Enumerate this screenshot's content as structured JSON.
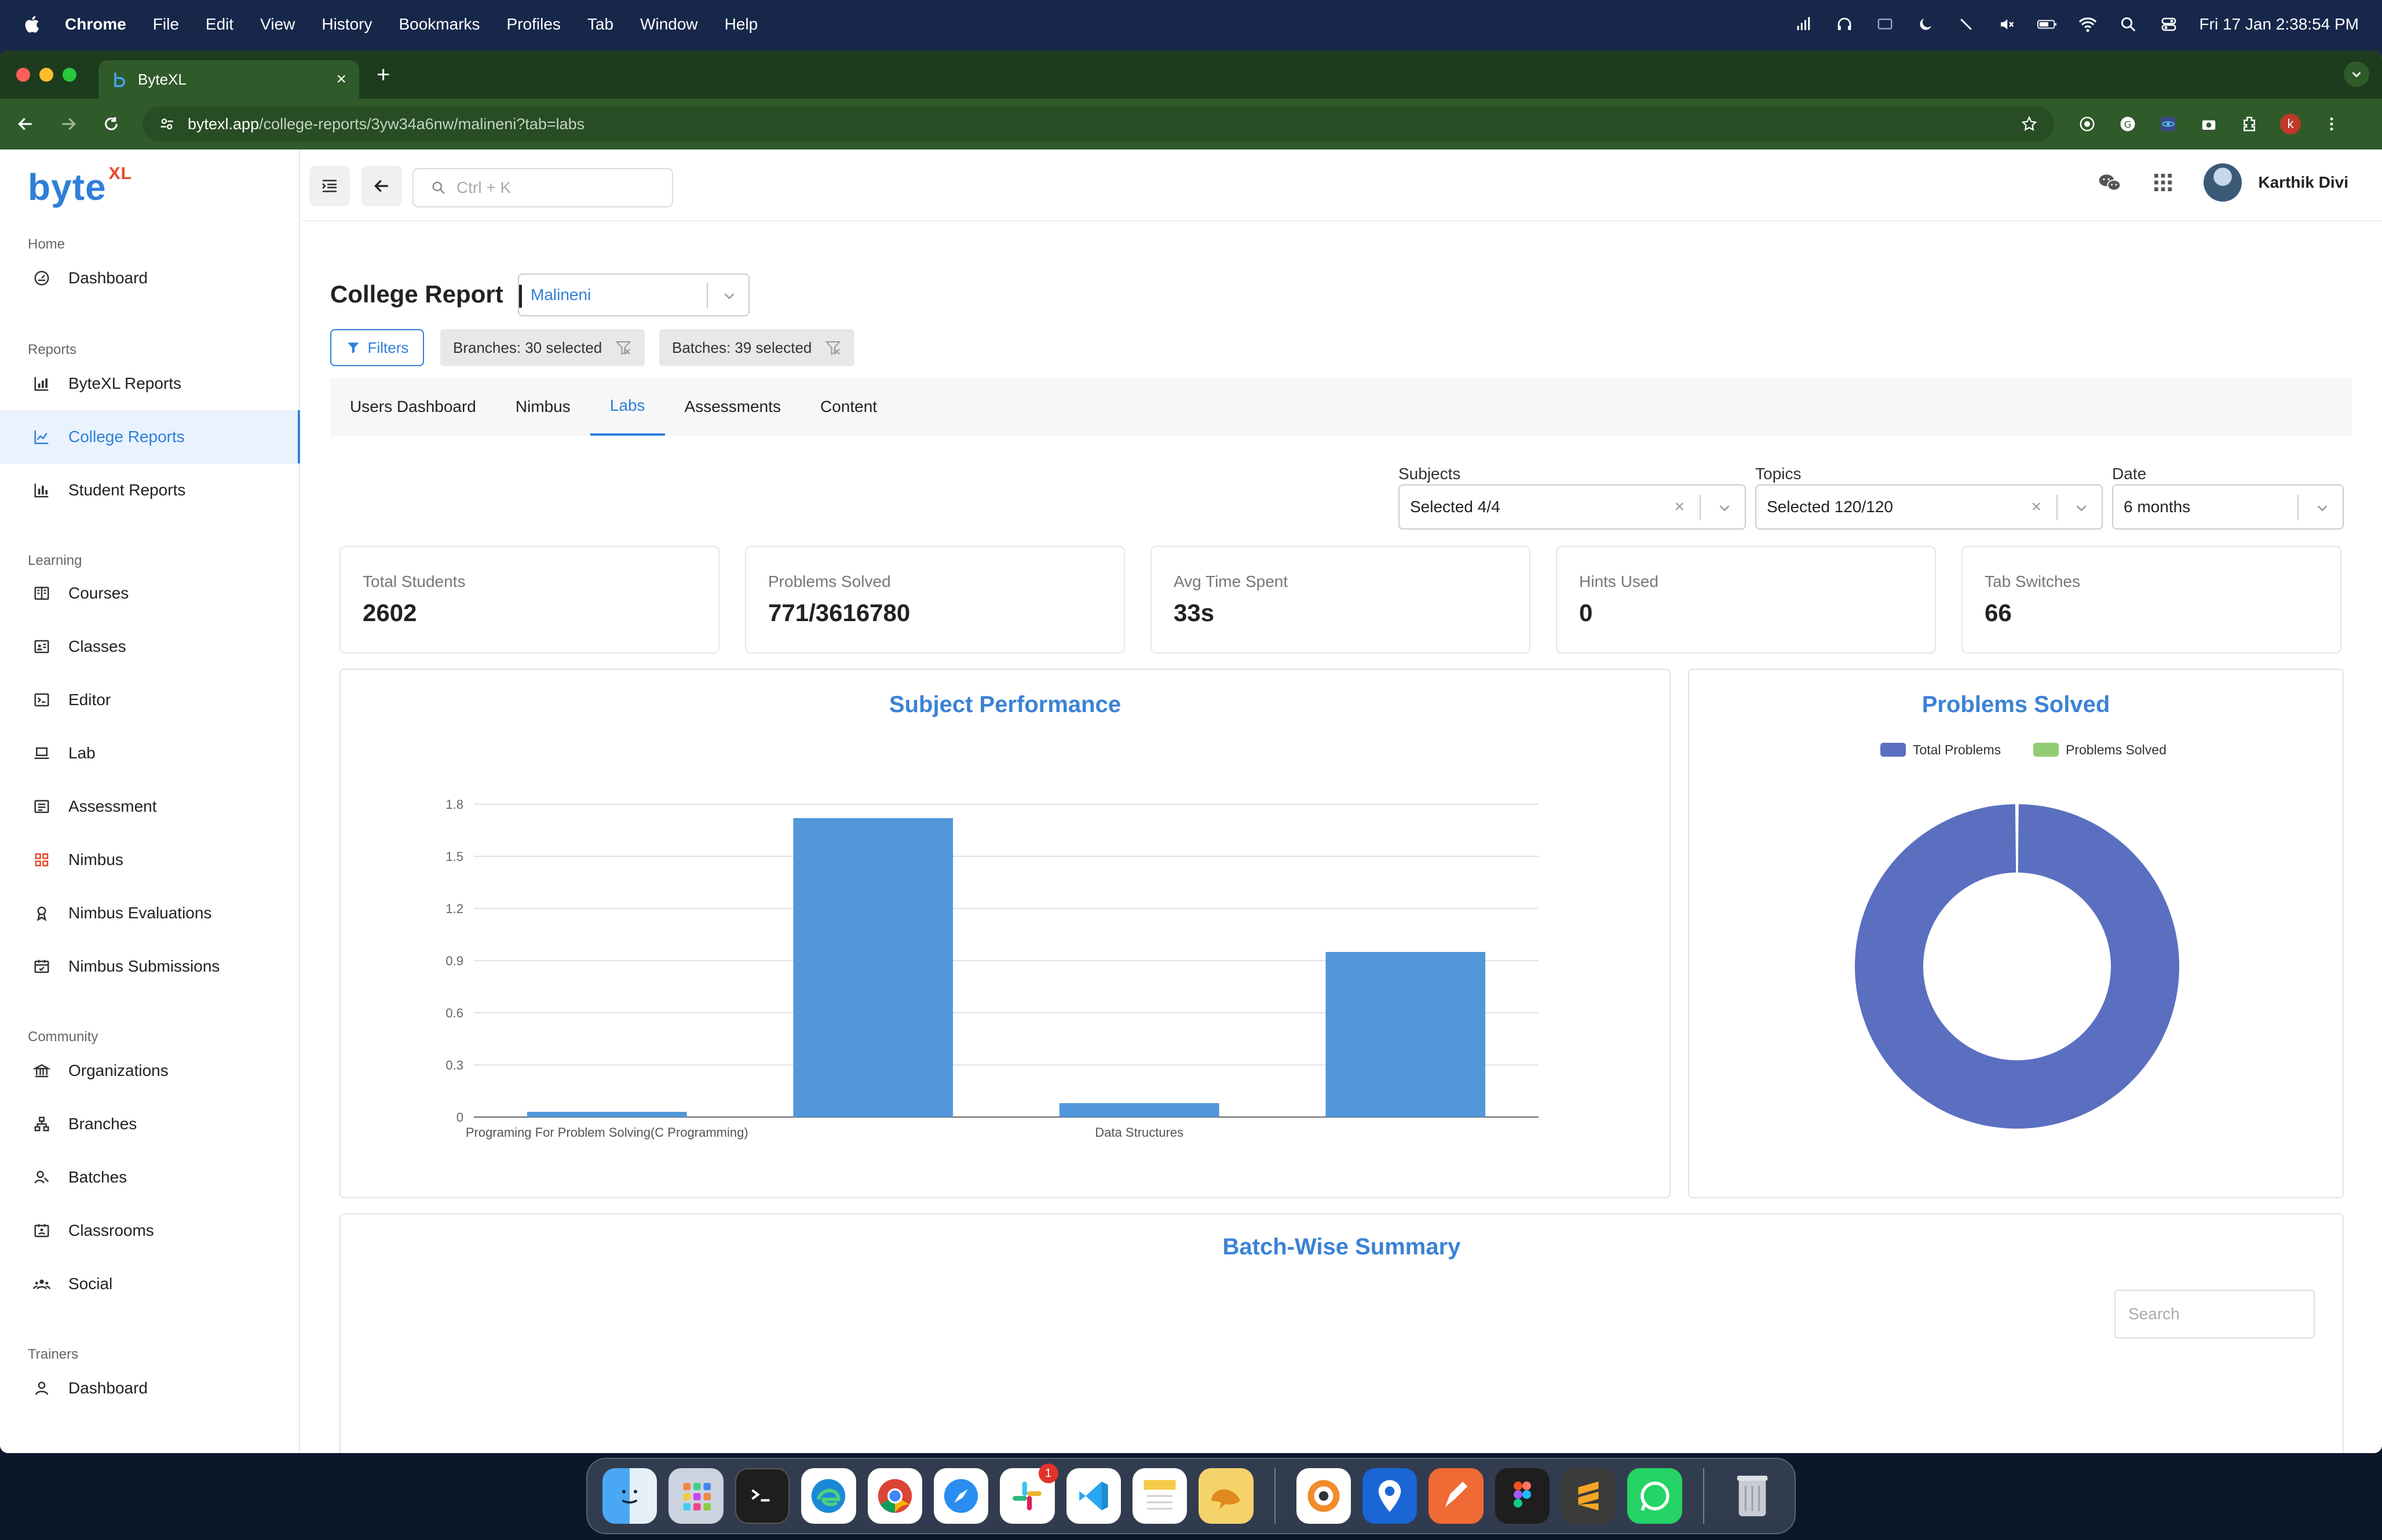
{
  "menubar": {
    "app": "Chrome",
    "items": [
      "File",
      "Edit",
      "View",
      "History",
      "Bookmarks",
      "Profiles",
      "Tab",
      "Window",
      "Help"
    ],
    "clock": "Fri 17 Jan  2:38:54 PM"
  },
  "browser": {
    "tab_title": "ByteXL",
    "url_host": "bytexl.app",
    "url_path": "/college-reports/3yw34a6nw/malineni?tab=labs",
    "profile_initial": "k"
  },
  "sidebar": {
    "logo": "byte",
    "logo_sup": "XL",
    "sections": {
      "home": "Home",
      "reports": "Reports",
      "learning": "Learning",
      "community": "Community",
      "trainers": "Trainers"
    },
    "items": [
      {
        "label": "Dashboard",
        "icon": "dashboard-icon"
      },
      {
        "label": "ByteXL Reports",
        "icon": "bar-chart-icon"
      },
      {
        "label": "College Reports",
        "icon": "line-chart-icon"
      },
      {
        "label": "Student Reports",
        "icon": "bar-chart-icon"
      },
      {
        "label": "Courses",
        "icon": "book-icon"
      },
      {
        "label": "Classes",
        "icon": "classes-icon"
      },
      {
        "label": "Editor",
        "icon": "terminal-icon"
      },
      {
        "label": "Lab",
        "icon": "laptop-icon"
      },
      {
        "label": "Assessment",
        "icon": "assessment-icon"
      },
      {
        "label": "Nimbus",
        "icon": "grid-icon"
      },
      {
        "label": "Nimbus Evaluations",
        "icon": "award-icon"
      },
      {
        "label": "Nimbus Submissions",
        "icon": "calendar-icon"
      },
      {
        "label": "Organizations",
        "icon": "bank-icon"
      },
      {
        "label": "Branches",
        "icon": "branches-icon"
      },
      {
        "label": "Batches",
        "icon": "batches-icon"
      },
      {
        "label": "Classrooms",
        "icon": "classroom-icon"
      },
      {
        "label": "Social",
        "icon": "social-icon"
      },
      {
        "label": "Dashboard",
        "icon": "user-icon"
      }
    ]
  },
  "topbar": {
    "search_placeholder": "Ctrl + K",
    "user_name": "Karthik Divi"
  },
  "report": {
    "title": "College Report",
    "separator": "|",
    "college": "Malineni",
    "filters_label": "Filters",
    "branches_chip": "Branches: 30 selected",
    "batches_chip": "Batches: 39 selected",
    "tabs": [
      "Users Dashboard",
      "Nimbus",
      "Labs",
      "Assessments",
      "Content"
    ],
    "active_tab": "Labs"
  },
  "filters": {
    "subjects_label": "Subjects",
    "subjects_value": "Selected 4/4",
    "topics_label": "Topics",
    "topics_value": "Selected 120/120",
    "date_label": "Date",
    "date_value": "6 months"
  },
  "stats": [
    {
      "label": "Total Students",
      "value": "2602"
    },
    {
      "label": "Problems Solved",
      "value": "771/3616780"
    },
    {
      "label": "Avg Time Spent",
      "value": "33s"
    },
    {
      "label": "Hints Used",
      "value": "0"
    },
    {
      "label": "Tab Switches",
      "value": "66"
    }
  ],
  "chart_data": [
    {
      "type": "bar",
      "title": "Subject Performance",
      "categories": [
        "Programing For Problem Solving(C Programming)",
        "",
        "Data Structures",
        ""
      ],
      "values": [
        0.03,
        1.72,
        0.08,
        0.95
      ],
      "yticks": [
        "0",
        "0.3",
        "0.6",
        "0.9",
        "1.2",
        "1.5",
        "1.8"
      ],
      "ylim": [
        0,
        1.8
      ],
      "grid": true,
      "color": "#5197d9"
    },
    {
      "type": "pie",
      "title": "Problems Solved",
      "legend": [
        "Total Problems",
        "Problems Solved"
      ],
      "legend_position": "top",
      "values": [
        3616780,
        771
      ],
      "colors": [
        "#5b6fc0",
        "#91cc75"
      ],
      "donut": true
    }
  ],
  "batch_summary": {
    "title": "Batch-Wise Summary",
    "search_placeholder": "Search"
  },
  "dock": {
    "apps": [
      "finder-icon",
      "launchpad-icon",
      "terminal-icon",
      "edge-icon",
      "chrome-icon",
      "safari-icon",
      "slack-icon",
      "vscode-icon",
      "notes-icon",
      "tableplus-icon",
      "podcast-icon",
      "pin-icon",
      "pen-icon",
      "figma-icon",
      "sublime-icon",
      "whatsapp-icon",
      "trash-icon"
    ],
    "slack_badge": "1"
  }
}
